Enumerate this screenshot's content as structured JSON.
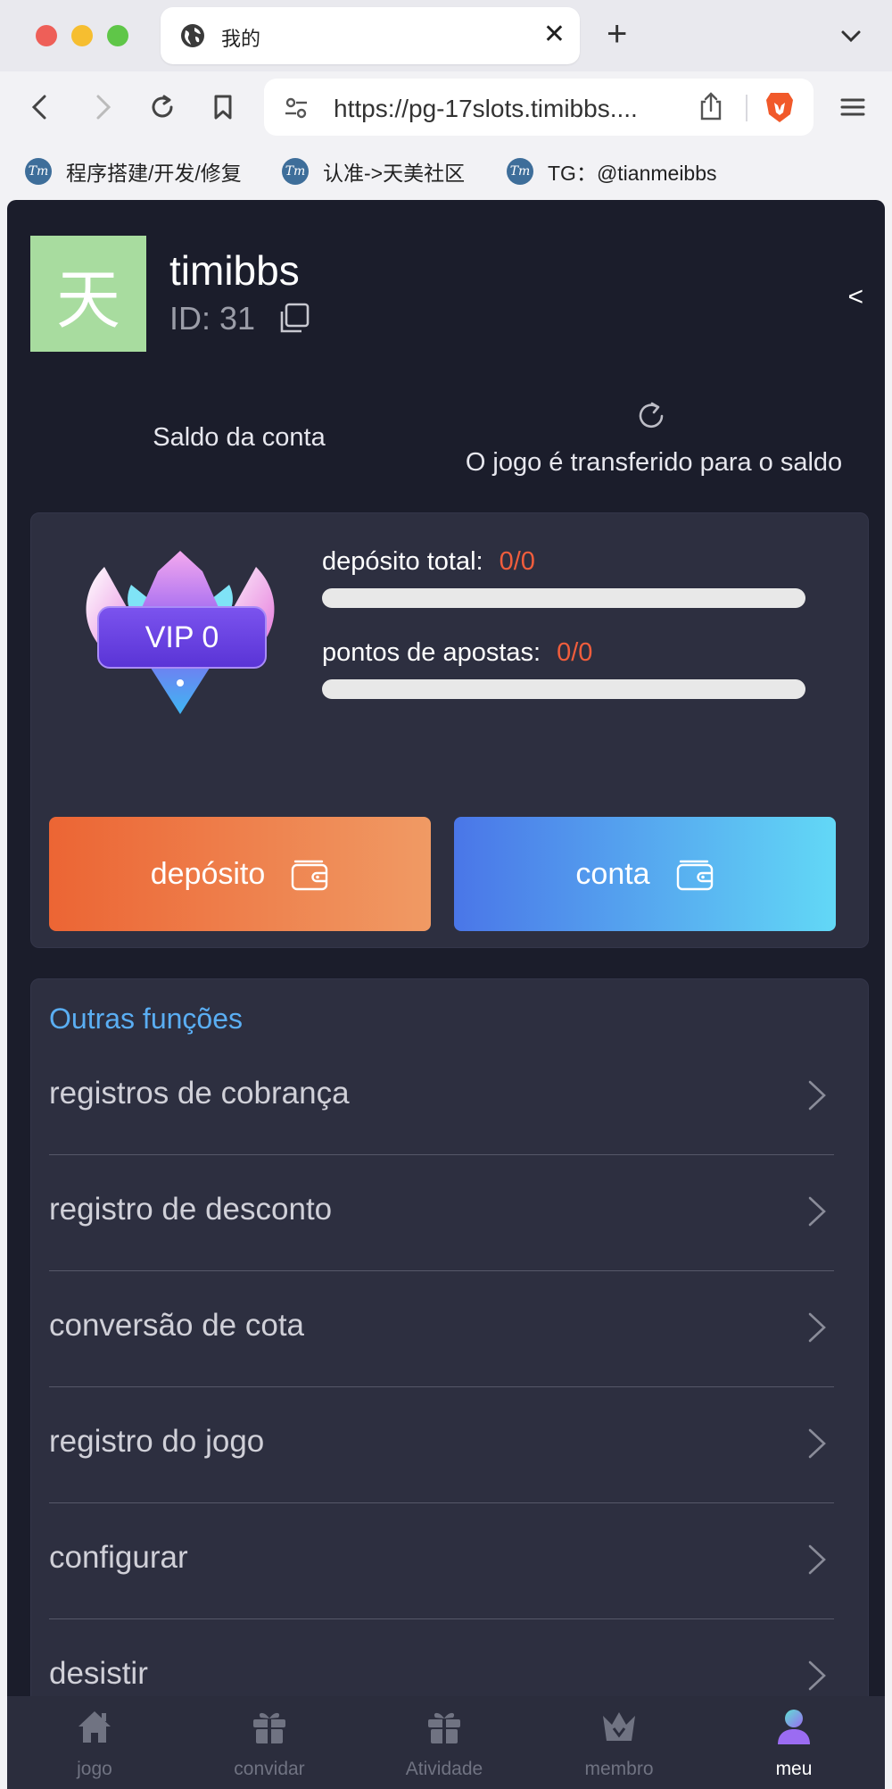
{
  "browser": {
    "tab_title": "我的",
    "url": "https://pg-17slots.timibbs....",
    "bookmarks": [
      {
        "label": "程序搭建/开发/修复"
      },
      {
        "label": "认准->天美社区"
      },
      {
        "label": "TG：@tianmeibbs"
      }
    ],
    "bookmark_icon_text": "Tm"
  },
  "profile": {
    "avatar_char": "天",
    "username": "timibbs",
    "id_text": "ID: 31",
    "back_glyph": "<"
  },
  "balance": {
    "left_label": "Saldo da conta",
    "right_label": "O jogo é transferido para o saldo"
  },
  "vip": {
    "level_label": "VIP 0",
    "deposit_label": "depósito total:",
    "deposit_value": "0/0",
    "deposit_progress": 0,
    "bet_label": "pontos de apostas:",
    "bet_value": "0/0",
    "bet_progress": 0
  },
  "actions": {
    "deposit_label": "depósito",
    "account_label": "conta"
  },
  "functions": {
    "title": "Outras funções",
    "items": [
      {
        "label": "registros de cobrança"
      },
      {
        "label": "registro de desconto"
      },
      {
        "label": "conversão de cota"
      },
      {
        "label": "registro do jogo"
      },
      {
        "label": "configurar"
      },
      {
        "label": "desistir"
      }
    ]
  },
  "bottom_nav": {
    "items": [
      {
        "label": "jogo",
        "icon": "home-icon"
      },
      {
        "label": "convidar",
        "icon": "gift-icon"
      },
      {
        "label": "Atividade",
        "icon": "gift-icon"
      },
      {
        "label": "membro",
        "icon": "crown-icon"
      },
      {
        "label": "meu",
        "icon": "user-icon",
        "active": true
      }
    ]
  },
  "colors": {
    "app_bg": "#1b1d2b",
    "card_bg": "#2d2f40",
    "accent_orange": "#f05d3c",
    "accent_blue": "#5aaef3"
  }
}
